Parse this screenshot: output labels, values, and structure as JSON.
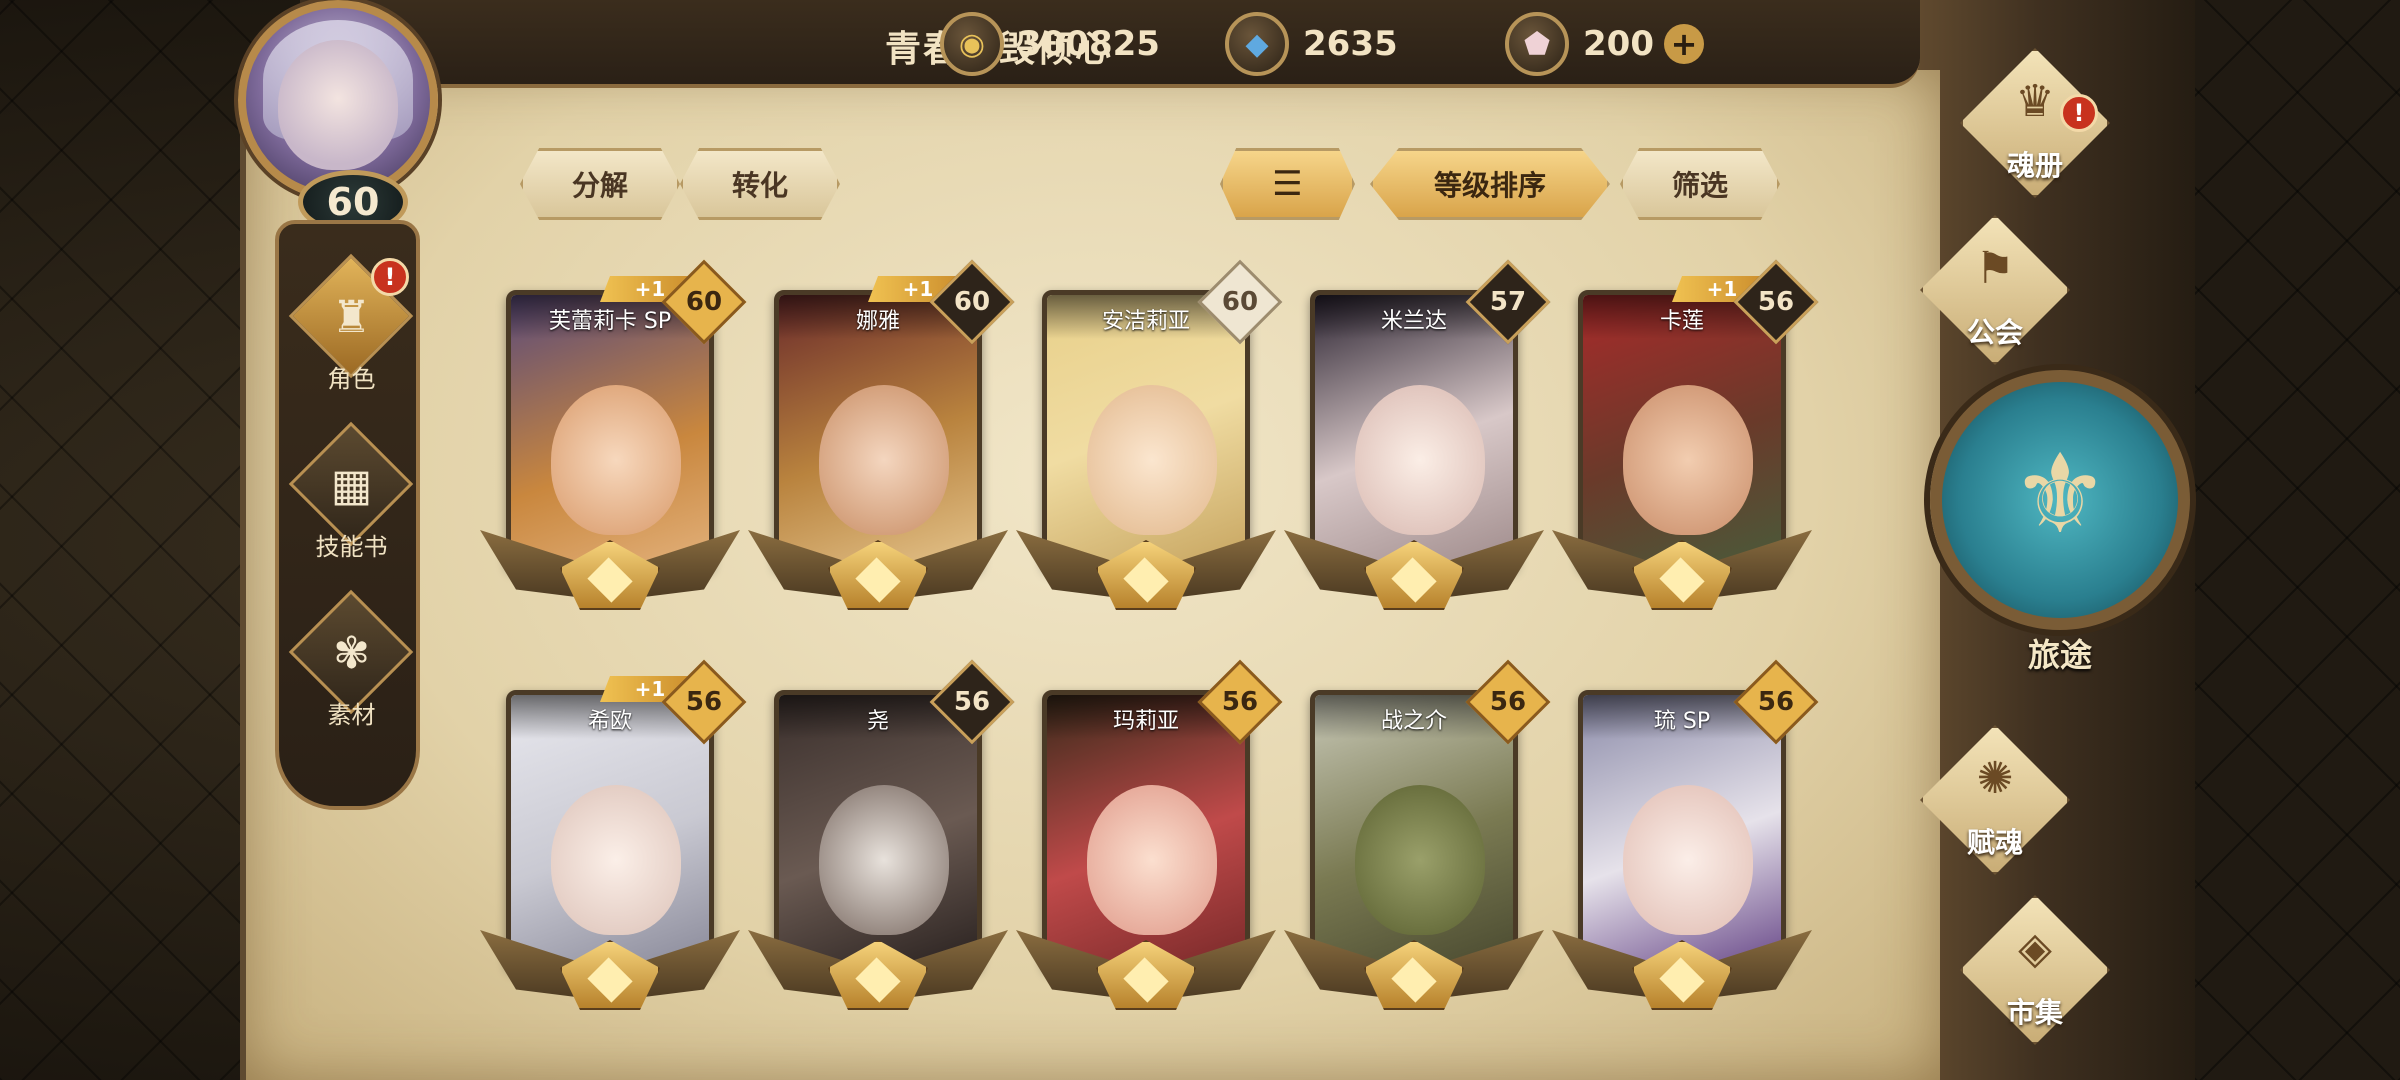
{
  "player": {
    "name": "青春梦毁倾心",
    "level": "60"
  },
  "currencies": [
    {
      "icon": "gold-coin-icon",
      "value": "300825"
    },
    {
      "icon": "blue-crystal-icon",
      "value": "2635"
    },
    {
      "icon": "pink-gem-icon",
      "value": "200",
      "plus": "+"
    }
  ],
  "sidebar": {
    "items": [
      {
        "label": "角色",
        "icon": "character-helmet-icon",
        "alert": "!"
      },
      {
        "label": "技能书",
        "icon": "skill-book-icon"
      },
      {
        "label": "素材",
        "icon": "material-creature-icon"
      }
    ]
  },
  "toolbar": {
    "decompose": "分解",
    "convert": "转化",
    "sort_icon": "sort-lines-icon",
    "level_sort": "等级排序",
    "filter": "筛选"
  },
  "cards": [
    {
      "name": "芙蕾莉卡 SP",
      "level": "60",
      "plus": "+1",
      "badge": "gold"
    },
    {
      "name": "娜雅",
      "level": "60",
      "plus": "+1",
      "badge": "dark"
    },
    {
      "name": "安洁莉亚",
      "level": "60",
      "plus": "",
      "badge": "light"
    },
    {
      "name": "米兰达",
      "level": "57",
      "plus": "",
      "badge": "dark"
    },
    {
      "name": "卡莲",
      "level": "56",
      "plus": "+1",
      "badge": "dark"
    },
    {
      "name": "希欧",
      "level": "56",
      "plus": "+1",
      "badge": "gold"
    },
    {
      "name": "尧",
      "level": "56",
      "plus": "",
      "badge": "dark"
    },
    {
      "name": "玛莉亚",
      "level": "56",
      "plus": "",
      "badge": "gold"
    },
    {
      "name": "战之介",
      "level": "56",
      "plus": "",
      "badge": "gold"
    },
    {
      "name": "琉 SP",
      "level": "56",
      "plus": "",
      "badge": "gold"
    }
  ],
  "right_menu": {
    "soulbook": {
      "label": "魂册",
      "icon": "soulbook-crown-icon",
      "alert": "!"
    },
    "guild": {
      "label": "公会",
      "icon": "guild-banner-icon"
    },
    "journey": {
      "label": "旅途",
      "icon": "journey-emblem-icon"
    },
    "endow": {
      "label": "赋魂",
      "icon": "endow-flame-icon"
    },
    "market": {
      "label": "市集",
      "icon": "market-gem-icon"
    }
  }
}
